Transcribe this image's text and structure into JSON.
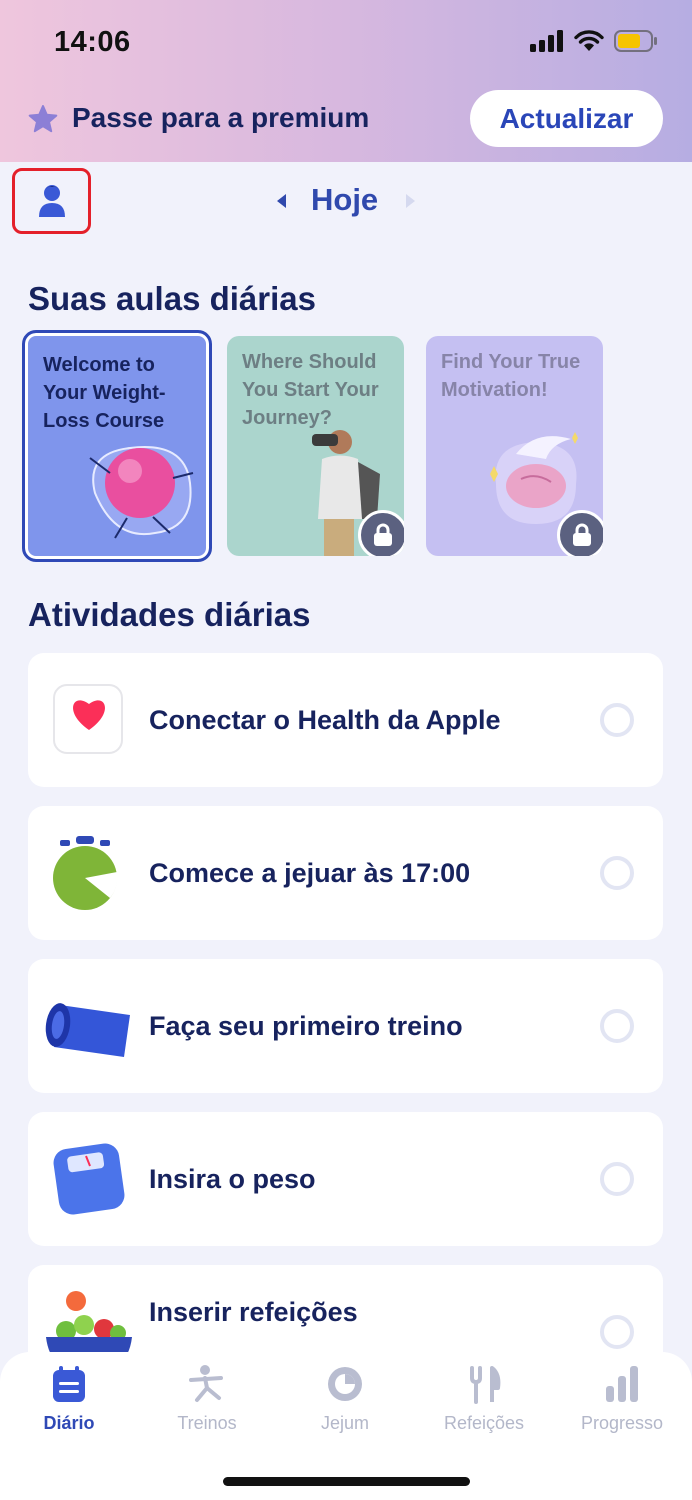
{
  "status_bar": {
    "time": "14:06",
    "signal_icon": "signal-bars-icon",
    "wifi_icon": "wifi-icon",
    "battery_icon": "battery-icon"
  },
  "premium_banner": {
    "text": "Passe para a premium",
    "button_label": "Actualizar",
    "icon": "star-icon"
  },
  "header": {
    "date_label": "Hoje",
    "profile_icon": "person-icon"
  },
  "lessons": {
    "title": "Suas aulas diárias",
    "items": [
      {
        "title": "Welcome to Your Weight-Loss Course",
        "locked": false
      },
      {
        "title": "Where Should You Start Your Journey?",
        "locked": true
      },
      {
        "title": "Find Your True Motivation!",
        "locked": true
      }
    ]
  },
  "activities": {
    "title": "Atividades diárias",
    "items": [
      {
        "label": "Conectar o Health da Apple",
        "icon": "heart-icon"
      },
      {
        "label": "Comece a jejuar às 17:00",
        "icon": "timer-icon"
      },
      {
        "label": "Faça seu primeiro treino",
        "icon": "yoga-mat-icon"
      },
      {
        "label": "Insira o peso",
        "icon": "scale-icon"
      },
      {
        "label": "Inserir refeições",
        "icon": "salad-bowl-icon"
      }
    ]
  },
  "tabs": [
    {
      "label": "Diário",
      "icon": "diary-icon",
      "active": true
    },
    {
      "label": "Treinos",
      "icon": "workout-icon",
      "active": false
    },
    {
      "label": "Jejum",
      "icon": "fasting-icon",
      "active": false
    },
    {
      "label": "Refeições",
      "icon": "fork-knife-icon",
      "active": false
    },
    {
      "label": "Progresso",
      "icon": "bar-chart-icon",
      "active": false
    }
  ],
  "colors": {
    "accent": "#2f49b6",
    "text_dark": "#17235e",
    "lesson1_bg": "#7f95ec",
    "lesson2_bg": "#abd5cd",
    "lesson3_bg": "#c5c0f2"
  }
}
